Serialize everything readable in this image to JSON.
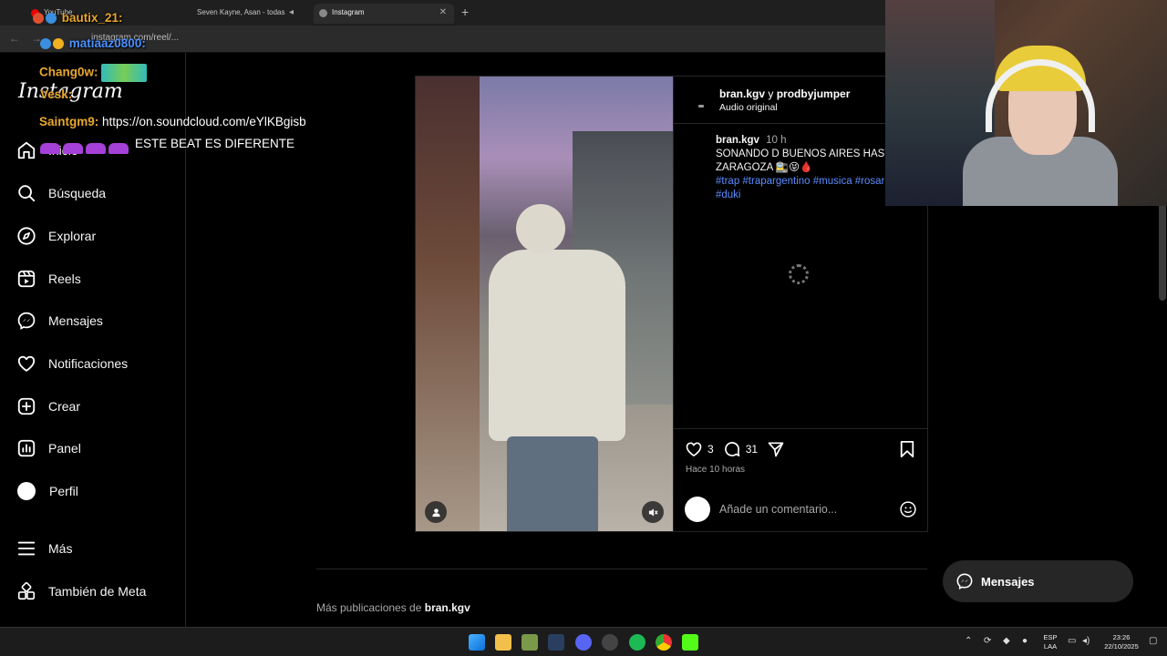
{
  "browser": {
    "tabs": [
      {
        "label": "YouTube"
      },
      {
        "label": "Seven Kayne, Asan - todas"
      },
      {
        "label": "Instagram"
      }
    ],
    "new_tab_icon": "plus-icon",
    "url": "instagram.com/reel/..."
  },
  "sidebar": {
    "logo": "Instagram",
    "items": [
      {
        "label": "Inicio",
        "icon": "home-icon"
      },
      {
        "label": "Búsqueda",
        "icon": "search-icon"
      },
      {
        "label": "Explorar",
        "icon": "compass-icon"
      },
      {
        "label": "Reels",
        "icon": "reels-icon"
      },
      {
        "label": "Mensajes",
        "icon": "messenger-icon"
      },
      {
        "label": "Notificaciones",
        "icon": "heart-icon"
      },
      {
        "label": "Crear",
        "icon": "plus-square-icon"
      },
      {
        "label": "Panel",
        "icon": "chart-icon"
      },
      {
        "label": "Perfil",
        "icon": "avatar-icon"
      },
      {
        "label": "Más",
        "icon": "menu-icon"
      },
      {
        "label": "También de Meta",
        "icon": "meta-icon"
      }
    ]
  },
  "post": {
    "header_user": "bran.kgv",
    "header_conj": "y",
    "header_collab": "prodbyjumper",
    "header_audio": "Audio original",
    "caption_user": "bran.kgv",
    "caption_time": "10 h",
    "caption_text": "SONANDO D BUENOS AIRES HASTA ZARAGOZA 🚉😝🩸",
    "caption_tags": "#trap #trapargentino #musica #rosario #duki",
    "likes": "3",
    "comments": "31",
    "time_ago": "Hace 10 horas",
    "comment_placeholder": "Añade un comentario..."
  },
  "more_posts": {
    "prefix": "Más publicaciones de",
    "user": "bran.kgv"
  },
  "messages_button": {
    "label": "Mensajes"
  },
  "stream_chat": [
    {
      "name": "bautix_21:",
      "msg": ""
    },
    {
      "name": "matiaaz0800:",
      "msg": ""
    },
    {
      "name": "Chang0w:",
      "msg": ""
    },
    {
      "name": "Vesk:",
      "msg": ""
    },
    {
      "name": "Saintgm9:",
      "msg": "https://on.soundcloud.com/eYlKBgisb"
    },
    {
      "name": "",
      "msg": "ESTE BEAT ES DIFERENTE"
    }
  ],
  "taskbar": {
    "lang_top": "ESP",
    "lang_bottom": "LAA",
    "time": "23:26",
    "date": "22/10/2025"
  },
  "colors": {
    "hashtag": "#5b8cff",
    "chat_name": "#e8a72f",
    "chat_name_alt": "#4a90ff"
  }
}
